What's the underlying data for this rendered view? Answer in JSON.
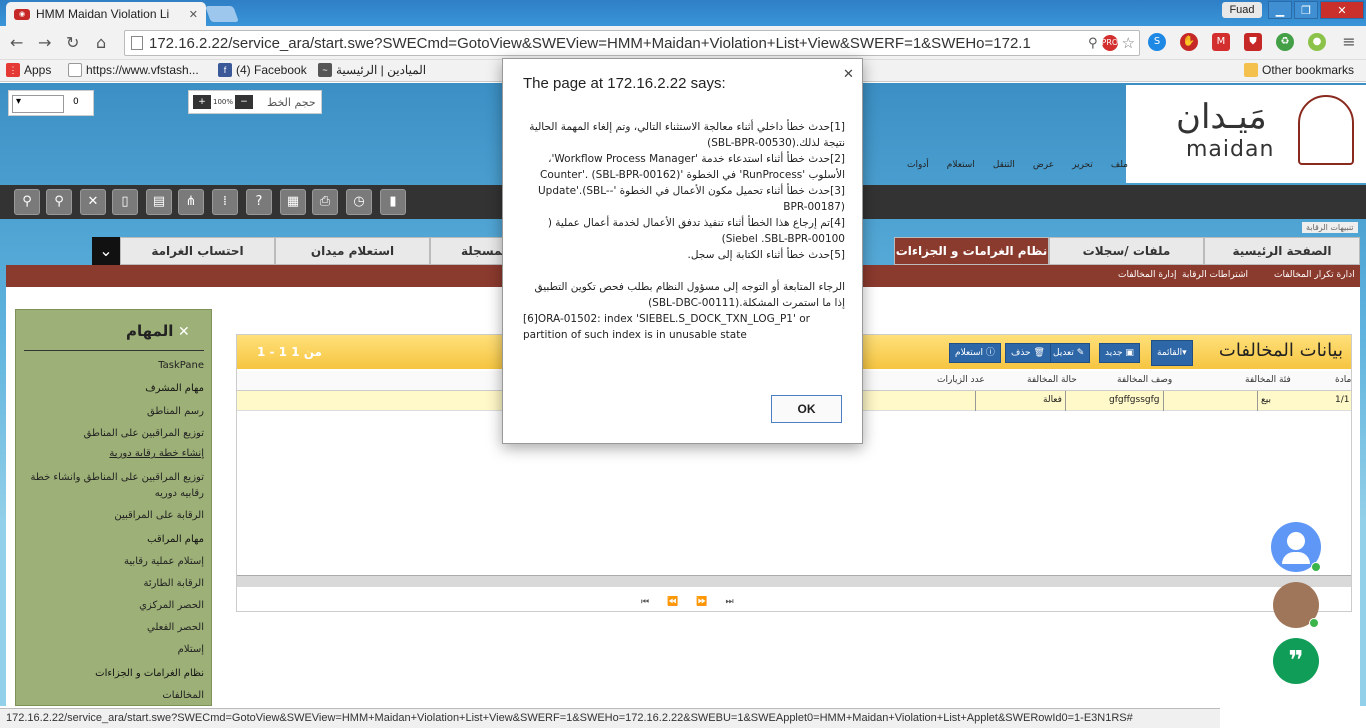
{
  "browser": {
    "tab_title": "HMM Maidan Violation Li",
    "user": "Fuad",
    "url": "172.16.2.22/service_ara/start.swe?SWECmd=GotoView&SWEView=HMM+Maidan+Violation+List+View&SWERF=1&SWEHo=172.1",
    "bookmarks": {
      "apps": "Apps",
      "b1": "https://www.vfstash...",
      "b2": "(4) Facebook",
      "b3": "الميادين | الرئيسية",
      "other": "Other bookmarks"
    },
    "status_url": "172.16.2.22/service_ara/start.swe?SWECmd=GotoView&SWEView=HMM+Maidan+Violation+List+View&SWERF=1&SWEHo=172.16.2.22&SWEBU=1&SWEApplet0=HMM+Maidan+Violation+List+Applet&SWERowId0=1-E3N1RS#"
  },
  "app": {
    "zoom_value": "0",
    "zoom_pct": "100%",
    "font_label": "حجم الخط",
    "logo_ar": "مَيـدان",
    "logo_en": "maidan",
    "menu": [
      "ملف",
      "تحرير",
      "عرض",
      "التنقل",
      "استعلام",
      "أدوات"
    ],
    "breadcrumb": "تنبيهات الرقابة",
    "tabs": [
      "الصفحة الرئيسية",
      "ملفات /سجلات",
      "نظام الغرامات و الجزاءات",
      "المسجلة",
      "استعلام ميدان",
      "احتساب الغرامة"
    ],
    "subnav": [
      "ادارة تكرار المخالفات",
      "اشتراطات الرقابة",
      "إدارة المخالفات"
    ]
  },
  "applet": {
    "title": "بيانات المخالفات",
    "menu_btn": "القائمة",
    "btn_new": "جديد",
    "btn_edit": "تعديل",
    "btn_delete": "حذف",
    "btn_query": "استعلام",
    "pager": "1 - 1 من 1",
    "columns": [
      "مادة",
      "فئة المخالفة",
      "وصف المخالفة",
      "حالة المخالفة",
      "عدد الزيارات"
    ],
    "row": [
      "1/1",
      "بيع",
      "gfgffgssgfg",
      "فعالة",
      ""
    ]
  },
  "taskpane": {
    "title": "المهام",
    "items": [
      "TaskPane",
      "مهام المشرف",
      "رسم المناطق",
      "توزيع المراقبين على المناطق",
      "إنشاء خطة رقابة دورية",
      "توزيع المراقبين على المناطق وانشاء خطة رقابيه دوريه",
      "الرقابة على المراقبين",
      "مهام المراقب",
      "إستلام عملية رقابية",
      "الرقابة الطارئة",
      "الحصر المركزي",
      "الحصر الفعلي",
      "إستلام",
      "نظام الغرامات و الجزاءات",
      "المخالفات"
    ]
  },
  "dialog": {
    "title": "The page at 172.16.2.22 says:",
    "lines": [
      "[1]حدث خطأ داخلي أثناء معالجة الاستثناء التالي، وتم إلغاء المهمة الحالية نتيجة لذلك.(SBL-BPR-00530)",
      "[2]حدث خطأ أثناء استدعاء خدمة 'Workflow Process Manager'، الأسلوب 'RunProcess' في الخطوة '(SBL-BPR-00162) .'Counter",
      "[3]حدث خطأ أثناء تحميل مكون الأعمال في الخطوة '-Update'.(SBL-BPR-00187)",
      "[4]تم إرجاع هذا الخطأ أثناء تنفيذ تدفق الأعمال لخدمة أعمال عملية ( Siebel .SBL-BPR-00100)",
      "[5]حدث خطأ أثناء الكتابة إلى سجل.",
      "",
      "الرجاء المتابعة أو التوجه إلى مسؤول النظام بطلب فحص تكوين التطبيق إذا ما استمرت المشكلة.(SBL-DBC-00111)"
    ],
    "oracle_line": "[6]ORA-01502: index 'SIEBEL.S_DOCK_TXN_LOG_P1' or partition of such index is in unusable state",
    "ok": "OK"
  }
}
